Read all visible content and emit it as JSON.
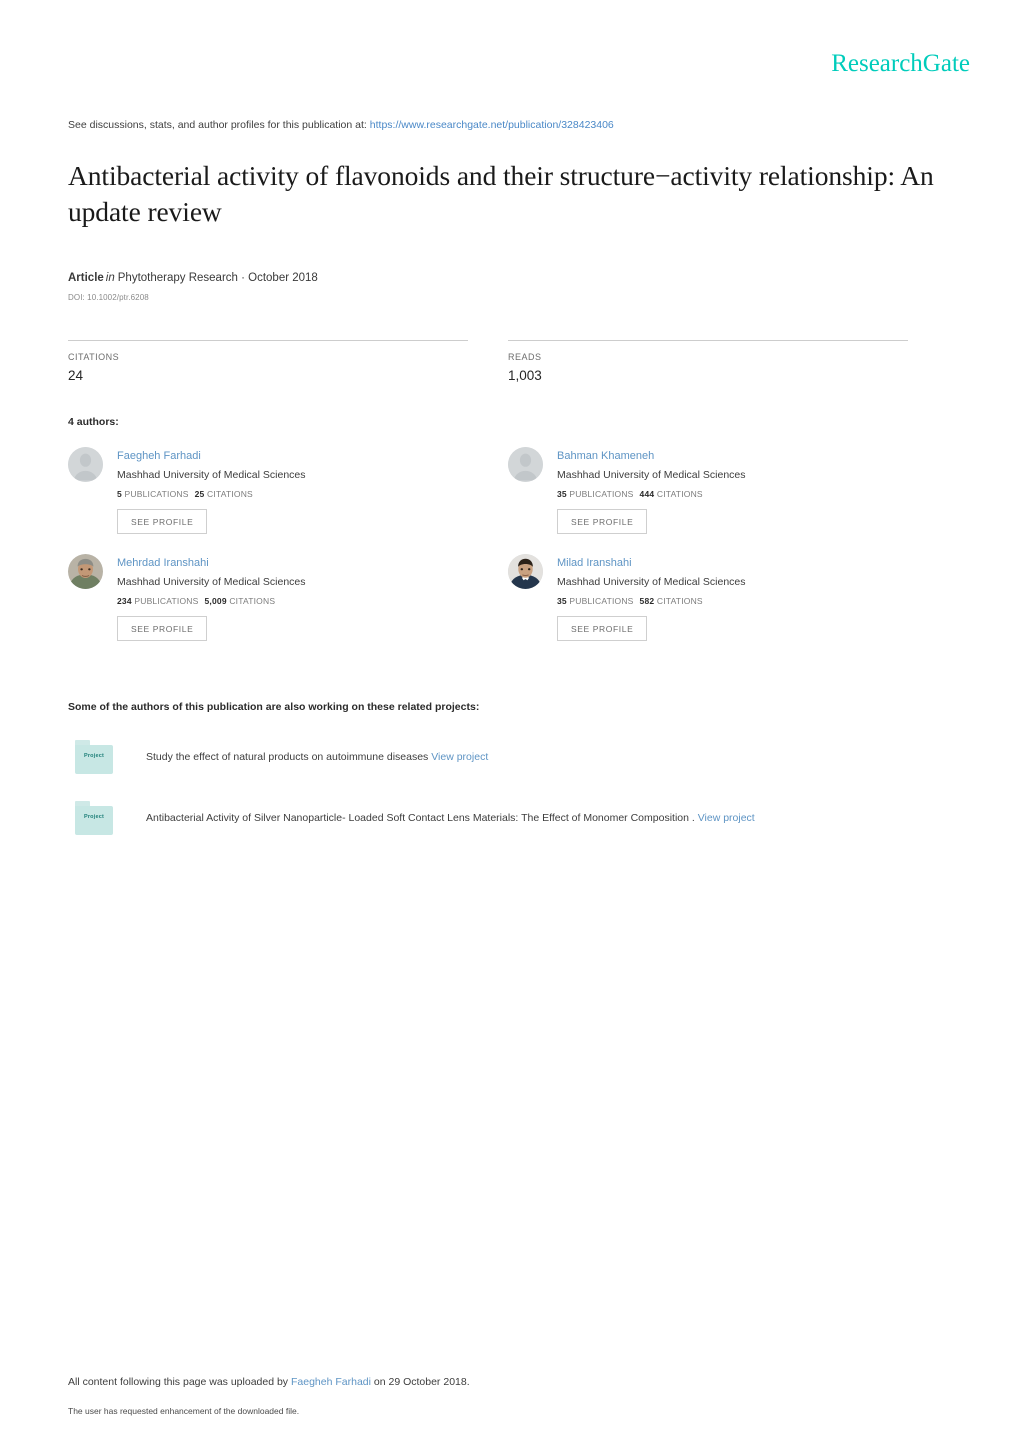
{
  "brand": {
    "logo_text": "ResearchGate",
    "logo_color": "#00ccbb"
  },
  "header": {
    "discussions_prefix": "See discussions, stats, and author profiles for this publication at:",
    "publication_url": "https://www.researchgate.net/publication/328423406"
  },
  "publication": {
    "title": "Antibacterial activity of flavonoids and their structure−activity relationship: An update review",
    "type_label": "Article",
    "in_label": "in",
    "journal_and_date": "Phytotherapy Research · October 2018",
    "doi": "DOI: 10.1002/ptr.6208"
  },
  "stats": [
    {
      "label": "CITATIONS",
      "value": "24"
    },
    {
      "label": "READS",
      "value": "1,003"
    }
  ],
  "authors_section": {
    "heading": "4 authors:",
    "see_profile_label": "SEE PROFILE",
    "publications_label": "PUBLICATIONS",
    "citations_label": "CITATIONS",
    "authors": [
      {
        "name": "Faegheh Farhadi",
        "institution": "Mashhad University of Medical Sciences",
        "publications": "5",
        "citations": "25",
        "avatar": "placeholder"
      },
      {
        "name": "Bahman Khameneh",
        "institution": "Mashhad University of Medical Sciences",
        "publications": "35",
        "citations": "444",
        "avatar": "placeholder"
      },
      {
        "name": "Mehrdad Iranshahi",
        "institution": "Mashhad University of Medical Sciences",
        "publications": "234",
        "citations": "5,009",
        "avatar": "photo-gray-hair"
      },
      {
        "name": "Milad Iranshahi",
        "institution": "Mashhad University of Medical Sciences",
        "publications": "35",
        "citations": "582",
        "avatar": "photo-dark-hair"
      }
    ]
  },
  "projects_section": {
    "heading": "Some of the authors of this publication are also working on these related projects:",
    "icon_label": "Project",
    "view_project_label": "View project",
    "projects": [
      {
        "title": "Study the effect of natural products on autoimmune diseases"
      },
      {
        "title": "Antibacterial Activity of Silver Nanoparticle- Loaded Soft Contact Lens Materials: The Effect of Monomer Composition ."
      }
    ]
  },
  "footer": {
    "upload_prefix": "All content following this page was uploaded by",
    "uploader_name": "Faegheh Farhadi",
    "upload_suffix": "on 29 October 2018.",
    "enhancement_note": "The user has requested enhancement of the downloaded file."
  }
}
